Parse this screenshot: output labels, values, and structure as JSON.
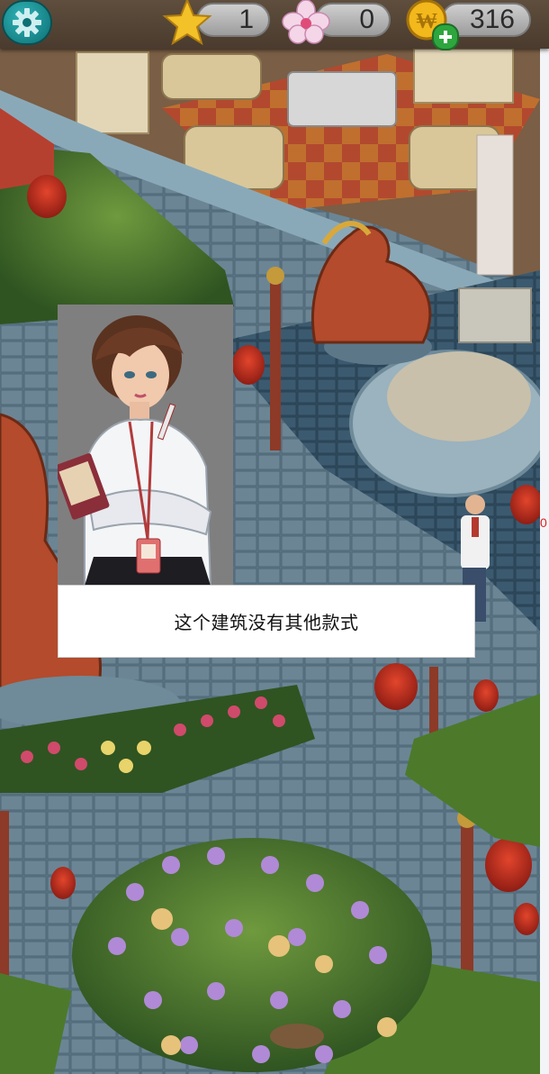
{
  "hud": {
    "stars": "1",
    "flowers": "0",
    "coins": "316",
    "icons": [
      "gear-icon",
      "star-icon",
      "flower-icon",
      "coin-icon",
      "plus-icon"
    ]
  },
  "dialog": {
    "message": "这个建筑没有其他款式"
  },
  "edge_marker": "0"
}
